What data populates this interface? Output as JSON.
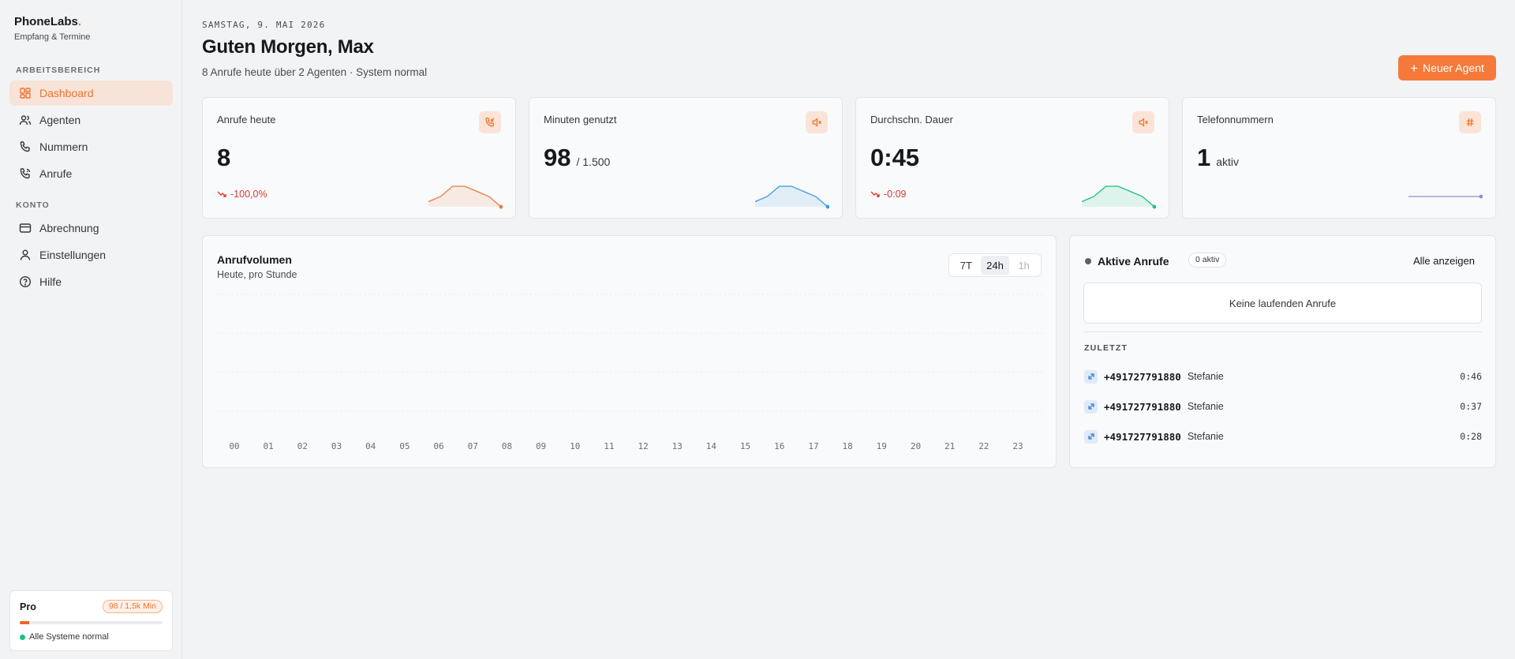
{
  "brand": {
    "name": "PhoneLabs",
    "dot": ".",
    "subtitle": "Empfang & Termine"
  },
  "sidebar": {
    "section_workspace": "ARBEITSBEREICH",
    "section_account": "KONTO",
    "items": [
      {
        "label": "Dashboard",
        "icon": "dashboard-icon"
      },
      {
        "label": "Agenten",
        "icon": "users-icon"
      },
      {
        "label": "Nummern",
        "icon": "phone-icon"
      },
      {
        "label": "Anrufe",
        "icon": "phone-call-icon"
      },
      {
        "label": "Abrechnung",
        "icon": "credit-card-icon"
      },
      {
        "label": "Einstellungen",
        "icon": "user-icon"
      },
      {
        "label": "Hilfe",
        "icon": "help-circle-icon"
      }
    ],
    "plan": {
      "name": "Pro",
      "usage_badge": "98 / 1,5k Min",
      "usage_fraction": 0.065,
      "status": "Alle Systeme normal"
    }
  },
  "header": {
    "date": "SAMSTAG, 9. MAI 2026",
    "greeting": "Guten Morgen, Max",
    "summary": "8 Anrufe heute über 2 Agenten · System normal",
    "new_agent_button": "Neuer Agent"
  },
  "stats": [
    {
      "label": "Anrufe heute",
      "value": "8",
      "unit": "",
      "delta": "-100,0%",
      "icon": "phone-incoming-icon"
    },
    {
      "label": "Minuten genutzt",
      "value": "98",
      "unit": "/ 1.500",
      "delta": "",
      "icon": "speaker-icon"
    },
    {
      "label": "Durchschn. Dauer",
      "value": "0:45",
      "unit": "",
      "delta": "-0:09",
      "icon": "speaker-icon"
    },
    {
      "label": "Telefonnummern",
      "value": "1",
      "unit": "aktiv",
      "delta": "",
      "icon": "hash-icon"
    }
  ],
  "colors": {
    "accent": "#f5793a",
    "spark_calls": "#f07a3c",
    "spark_minutes": "#3b9bdf",
    "spark_duration": "#1cc27a",
    "spark_numbers": "#8c8fd6",
    "negative": "#e0382e"
  },
  "volume": {
    "title": "Anrufvolumen",
    "subtitle": "Heute, pro Stunde",
    "ranges": [
      "7T",
      "24h",
      "1h"
    ],
    "active_range": "24h",
    "hours": [
      "00",
      "01",
      "02",
      "03",
      "04",
      "05",
      "06",
      "07",
      "08",
      "09",
      "10",
      "11",
      "12",
      "13",
      "14",
      "15",
      "16",
      "17",
      "18",
      "19",
      "20",
      "21",
      "22",
      "23"
    ]
  },
  "active_calls": {
    "title": "Aktive Anrufe",
    "badge": "0 aktiv",
    "show_all": "Alle anzeigen",
    "empty": "Keine laufenden Anrufe",
    "recent_heading": "ZULETZT",
    "recent": [
      {
        "number": "+491727791880",
        "name": "Stefanie",
        "duration": "0:46"
      },
      {
        "number": "+491727791880",
        "name": "Stefanie",
        "duration": "0:37"
      },
      {
        "number": "+491727791880",
        "name": "Stefanie",
        "duration": "0:28"
      }
    ]
  },
  "chart_data": [
    {
      "type": "area",
      "values": [
        0,
        1,
        3,
        3,
        2,
        1,
        -1
      ]
    },
    {
      "type": "area",
      "values": [
        0,
        1,
        3,
        3,
        2,
        1,
        -1
      ]
    },
    {
      "type": "area",
      "values": [
        0,
        1,
        3,
        3,
        2,
        1,
        -1
      ]
    },
    {
      "type": "line",
      "values": [
        1,
        1,
        1,
        1,
        1,
        1,
        1
      ]
    },
    {
      "type": "bar",
      "title": "Anrufvolumen",
      "categories": [
        "00",
        "01",
        "02",
        "03",
        "04",
        "05",
        "06",
        "07",
        "08",
        "09",
        "10",
        "11",
        "12",
        "13",
        "14",
        "15",
        "16",
        "17",
        "18",
        "19",
        "20",
        "21",
        "22",
        "23"
      ],
      "values": [
        0,
        0,
        0,
        0,
        0,
        0,
        0,
        0,
        0,
        0,
        0,
        0,
        0,
        0,
        0,
        0,
        0,
        0,
        0,
        0,
        0,
        0,
        0,
        0
      ],
      "grid": true
    }
  ]
}
